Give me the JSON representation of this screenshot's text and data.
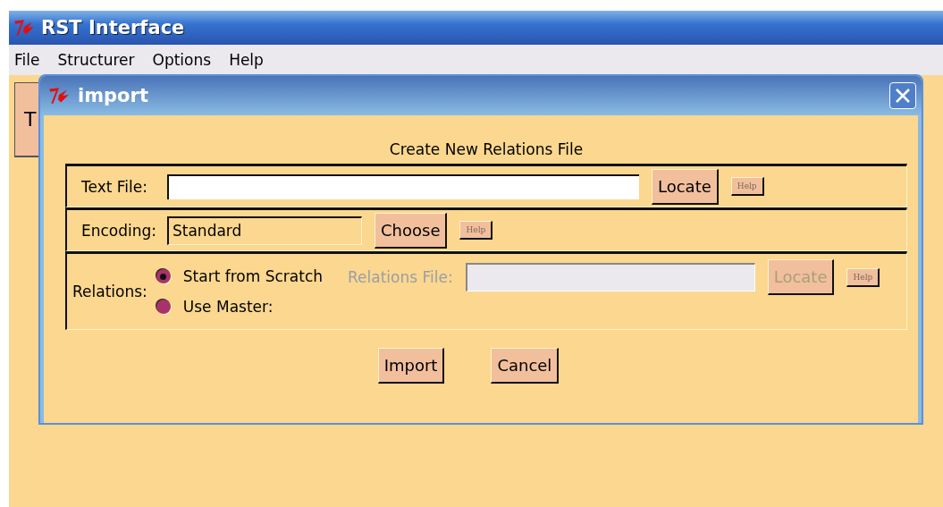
{
  "window": {
    "title": "RST Interface"
  },
  "menu": [
    "File",
    "Structurer",
    "Options",
    "Help"
  ],
  "background_button": {
    "label": "T"
  },
  "dialog": {
    "title": "import",
    "heading": "Create New Relations File",
    "text_file": {
      "label": "Text File:",
      "locate": "Locate",
      "help": "Help"
    },
    "encoding": {
      "label": "Encoding:",
      "value": "Standard",
      "choose": "Choose",
      "help": "Help"
    },
    "relations": {
      "label": "Relations:",
      "options": [
        {
          "label": "Start from Scratch",
          "selected": true
        },
        {
          "label": "Use Master:",
          "selected": false
        }
      ],
      "file_label": "Relations File:",
      "disabled": true,
      "locate": "Locate",
      "help": "Help"
    },
    "buttons": [
      "Import",
      "Cancel"
    ]
  }
}
